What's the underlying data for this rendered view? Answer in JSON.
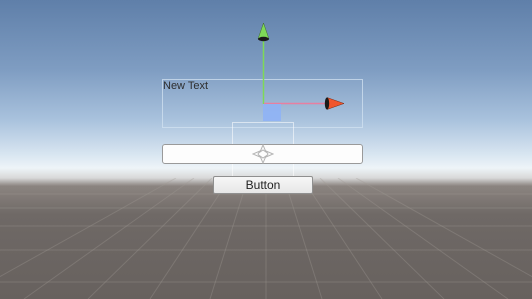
{
  "scene": {
    "text_label": "New Text",
    "button_label": "Button"
  },
  "gizmo": {
    "icons": [
      "move-gizmo-y-arrow-icon",
      "move-gizmo-x-arrow-icon",
      "move-gizmo-center-handle-icon"
    ],
    "colors": {
      "y_axis": "#7ed957",
      "x_axis": "#f0562e",
      "center": "#8fb3f5"
    }
  },
  "icons": [
    "rect-transform-anchor-icon"
  ]
}
